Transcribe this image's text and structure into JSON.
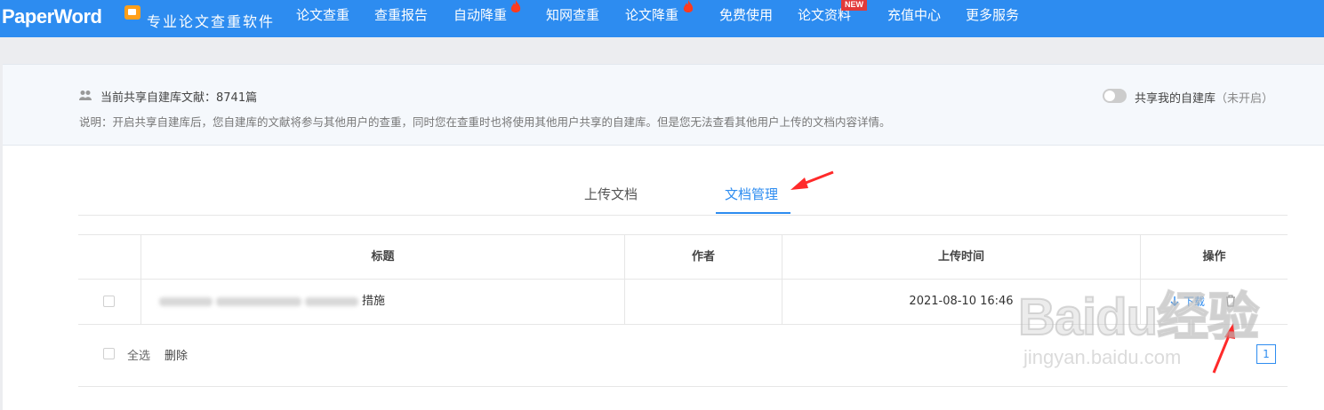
{
  "header": {
    "logo_text": "PaperWord",
    "slogan": "专业论文查重软件",
    "nav": [
      {
        "label": "论文查重"
      },
      {
        "label": "查重报告"
      },
      {
        "label": "自动降重"
      },
      {
        "label": "知网查重"
      },
      {
        "label": "论文降重"
      },
      {
        "label": "免费使用"
      },
      {
        "label": "论文资料"
      },
      {
        "label": "充值中心"
      },
      {
        "label": "更多服务"
      }
    ],
    "new_badge": "NEW"
  },
  "info": {
    "count_text": "当前共享自建库文献：8741篇",
    "description": "说明：开启共享自建库后，您自建库的文献将参与其他用户的查重，同时您在查重时也将使用其他用户共享的自建库。但是您无法查看其他用户上传的文档内容详情。",
    "toggle_label": "共享我的自建库",
    "toggle_status": "（未开启）"
  },
  "tabs": [
    {
      "label": "上传文档",
      "active": false
    },
    {
      "label": "文档管理",
      "active": true
    }
  ],
  "table": {
    "columns": [
      "标题",
      "作者",
      "上传时间",
      "操作"
    ],
    "rows": [
      {
        "title_visible": "措施",
        "author": "",
        "upload_time": "2021-08-10 16:46",
        "download": "下载"
      }
    ]
  },
  "footer": {
    "select_all": "全选",
    "delete": "删除",
    "current_page": "1"
  },
  "watermark": {
    "big": "Baidu经验",
    "small": "jingyan.baidu.com"
  },
  "colors": {
    "brand": "#2d8cf0",
    "fire": "#ff3b1f",
    "annotation_arrow": "#ff2a2a"
  }
}
